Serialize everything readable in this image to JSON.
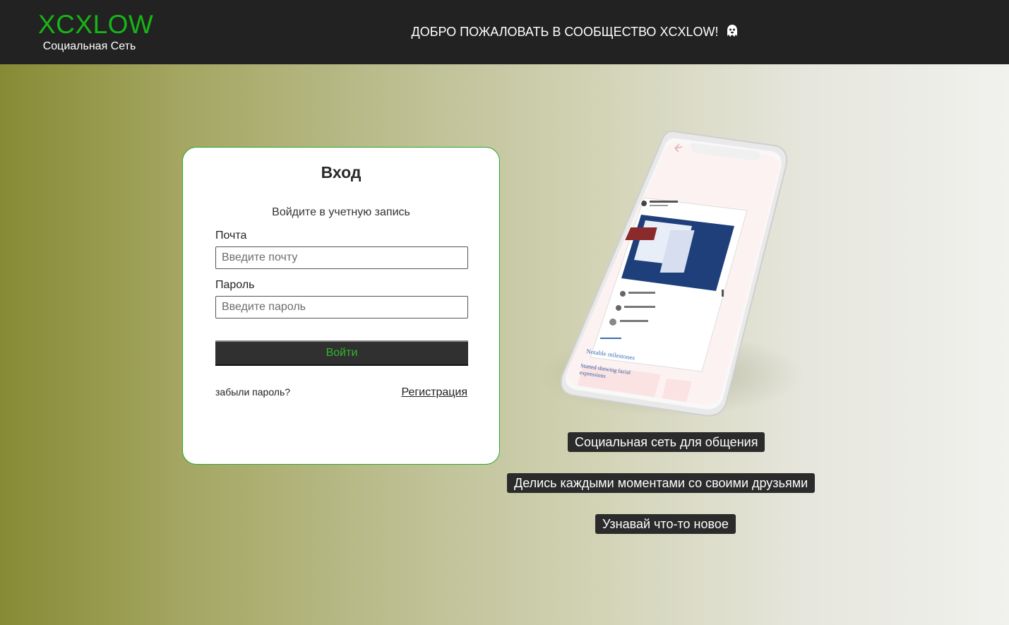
{
  "header": {
    "brand": "XCXLOW",
    "tagline": "Социальная Сеть",
    "welcome": "ДОБРО ПОЖАЛОВАТЬ В СООБЩЕСТВО XCXLOW!"
  },
  "login": {
    "title": "Вход",
    "subtitle": "Войдите в учетную запись",
    "email_label": "Почта",
    "email_placeholder": "Введите почту",
    "email_value": "",
    "password_label": "Пароль",
    "password_placeholder": "Введите пароль",
    "password_value": "",
    "submit": "Войти",
    "forgot": "забыли пароль?",
    "register": "Регистрация"
  },
  "promo": {
    "phone_screen": {
      "milestones_heading": "Notable milestones",
      "milestone_card": "Started showing facial expressions"
    },
    "lines": [
      "Социальная сеть для общения",
      "Делись каждыми моментами со своими друзьями",
      "Узнавай что-то новое"
    ]
  },
  "colors": {
    "brand_green": "#16b516",
    "header_bg": "#222222",
    "pill_bg": "#2b2b2b"
  }
}
